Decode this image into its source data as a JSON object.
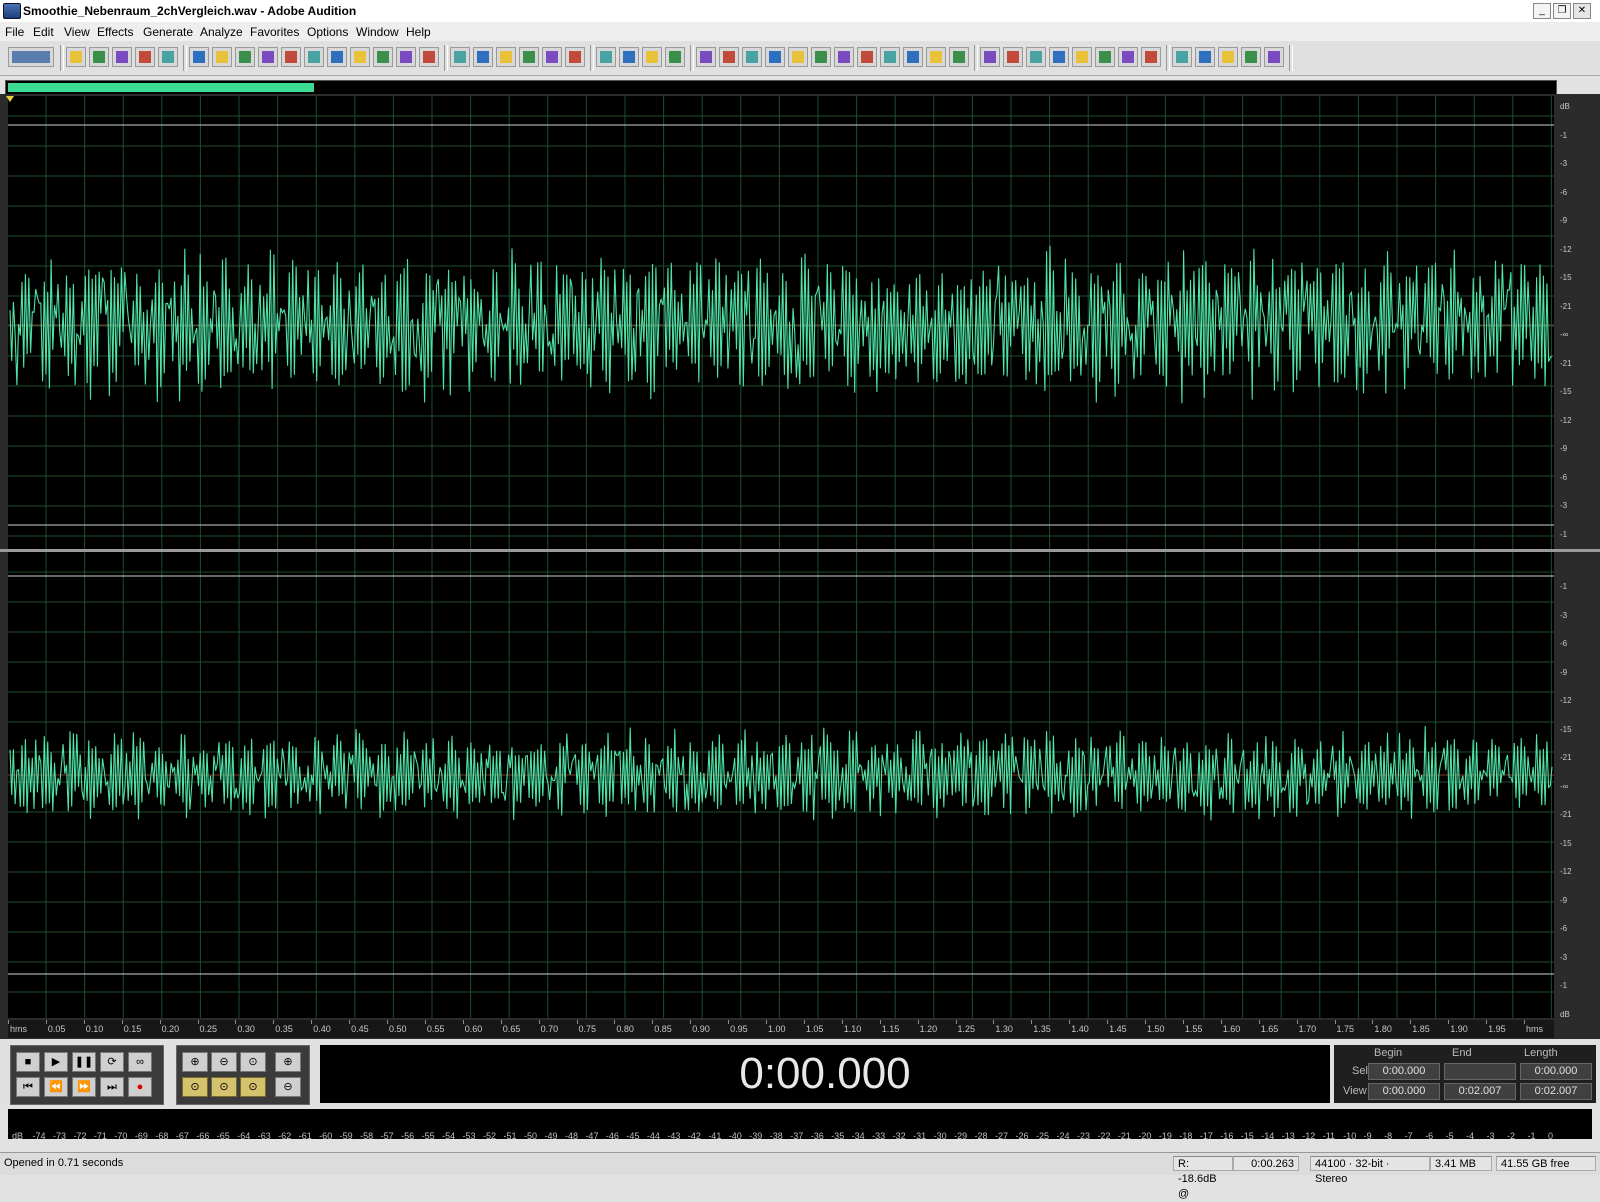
{
  "window": {
    "title": "Smoothie_Nebenraum_2chVergleich.wav - Adobe Audition",
    "controls": [
      "_",
      "❐",
      "✕"
    ]
  },
  "menu": [
    "File",
    "Edit",
    "View",
    "Effects",
    "Generate",
    "Analyze",
    "Favorites",
    "Options",
    "Window",
    "Help"
  ],
  "toolbar": {
    "icons": [
      "mode-switch-icon",
      "new-file-icon",
      "open-icon",
      "save-icon",
      "save-as-icon",
      "save-all-icon",
      "undo-icon",
      "redo-icon",
      "cut-silence-icon",
      "mix-paste-icon",
      "copy-new-icon",
      "cut-icon",
      "paste-icon",
      "paste-new-icon",
      "mix-icon",
      "trim-icon",
      "scrub-icon",
      "envelope-icon",
      "hybrid-icon",
      "spectral-icon",
      "spectral-pan-icon",
      "phase-icon",
      "amplify-icon",
      "normalize-icon",
      "fade-icon",
      "dynamics-icon",
      "compressor-icon",
      "invert-icon",
      "reverse-icon",
      "silence-icon",
      "delay-icon",
      "echo-icon",
      "chorus-icon",
      "flanger-icon",
      "noise-gate-icon",
      "eq-icon",
      "graphic-eq-icon",
      "filter-icon",
      "stretch-icon",
      "pitch-icon",
      "frequency-analysis-icon",
      "phase-analysis-icon",
      "statistics-icon",
      "batch-icon",
      "scripts-icon",
      "cd-icon",
      "markers-icon",
      "grid-icon",
      "settings-icon",
      "loop-icon",
      "metronome-icon",
      "view-icon"
    ]
  },
  "overview": {
    "fill_fraction": 0.198
  },
  "editor": {
    "top_channel": {
      "db_labels": [
        "dB",
        "-1",
        "-3",
        "-6",
        "-9",
        "-12",
        "-15",
        "-21",
        "-∞",
        "-21",
        "-15",
        "-12",
        "-9",
        "-6",
        "-3",
        "-1"
      ]
    },
    "bottom_channel": {
      "db_labels": [
        "-1",
        "-3",
        "-6",
        "-9",
        "-12",
        "-15",
        "-21",
        "-∞",
        "-21",
        "-15",
        "-12",
        "-9",
        "-6",
        "-3",
        "-1",
        "dB"
      ]
    },
    "time_ruler": [
      "hms",
      "0.05",
      "0.10",
      "0.15",
      "0.20",
      "0.25",
      "0.30",
      "0.35",
      "0.40",
      "0.45",
      "0.50",
      "0.55",
      "0.60",
      "0.65",
      "0.70",
      "0.75",
      "0.80",
      "0.85",
      "0.90",
      "0.95",
      "1.00",
      "1.05",
      "1.10",
      "1.15",
      "1.20",
      "1.25",
      "1.30",
      "1.35",
      "1.40",
      "1.45",
      "1.50",
      "1.55",
      "1.60",
      "1.65",
      "1.70",
      "1.75",
      "1.80",
      "1.85",
      "1.90",
      "1.95",
      "hms"
    ],
    "waveform_color": "#4fe3a6",
    "background_color": "#000000",
    "grid_color": "#1d4d2d"
  },
  "transport": {
    "time": "0:00.000",
    "buttons": [
      "■",
      "▶",
      "❚❚",
      "⟳",
      "∞",
      "⏮",
      "⏪",
      "⏩",
      "⏭",
      "●"
    ],
    "zoom_buttons": [
      "⊕",
      "⊖",
      "⊙",
      "⊕",
      "⊙",
      "⊙",
      "⊙",
      "⊖"
    ]
  },
  "selection": {
    "headers": {
      "begin": "Begin",
      "end": "End",
      "length": "Length"
    },
    "sel": {
      "label": "Sel",
      "begin": "0:00.000",
      "end": "",
      "length": "0:00.000"
    },
    "view": {
      "label": "View",
      "begin": "0:00.000",
      "end": "0:02.007",
      "length": "0:02.007"
    }
  },
  "meter": {
    "labels": [
      "dB",
      "-74",
      "-73",
      "-72",
      "-71",
      "-70",
      "-69",
      "-68",
      "-67",
      "-66",
      "-65",
      "-64",
      "-63",
      "-62",
      "-61",
      "-60",
      "-59",
      "-58",
      "-57",
      "-56",
      "-55",
      "-54",
      "-53",
      "-52",
      "-51",
      "-50",
      "-49",
      "-48",
      "-47",
      "-46",
      "-45",
      "-44",
      "-43",
      "-42",
      "-41",
      "-40",
      "-39",
      "-38",
      "-37",
      "-36",
      "-35",
      "-34",
      "-33",
      "-32",
      "-31",
      "-30",
      "-29",
      "-28",
      "-27",
      "-26",
      "-25",
      "-24",
      "-23",
      "-22",
      "-21",
      "-20",
      "-19",
      "-18",
      "-17",
      "-16",
      "-15",
      "-14",
      "-13",
      "-12",
      "-11",
      "-10",
      "-9",
      "-8",
      "-7",
      "-6",
      "-5",
      "-4",
      "-3",
      "-2",
      "-1",
      "0"
    ]
  },
  "status": {
    "message": "Opened in 0.71 seconds",
    "level": "R: -18.6dB @",
    "level_time": "0:00.263",
    "format": "44100 · 32-bit · Stereo",
    "size": "3.41 MB",
    "free": "41.55 GB free"
  }
}
